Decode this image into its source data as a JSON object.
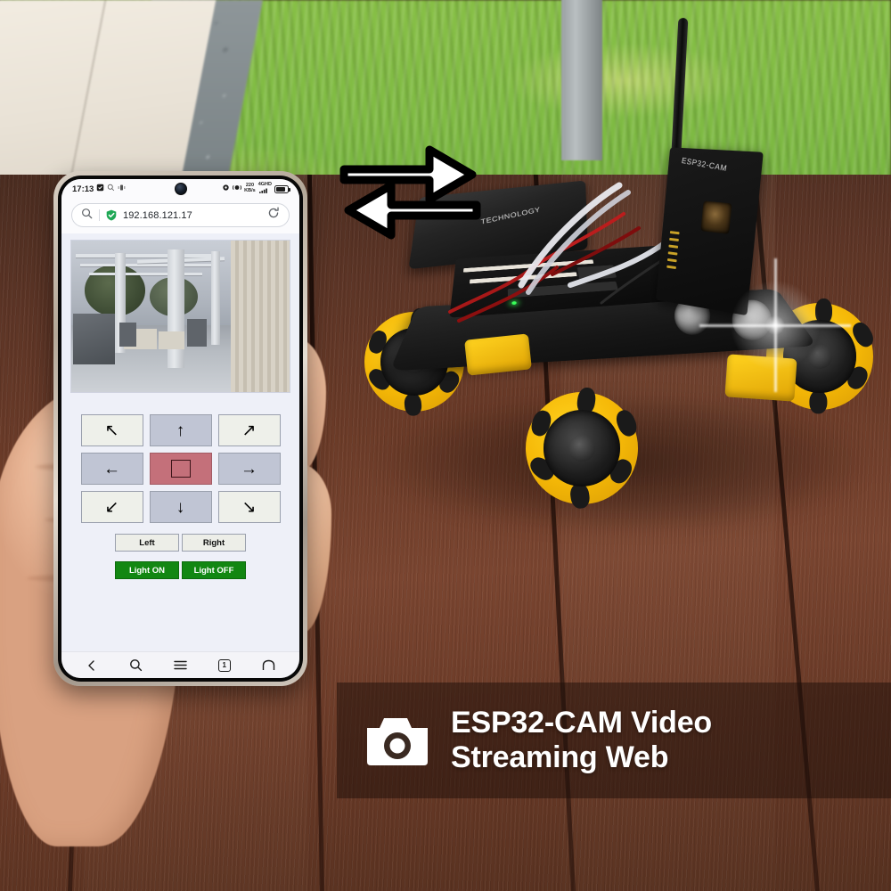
{
  "scene": {
    "description": "Outdoor wooden deck with grass and gravel background",
    "surface": "dark brown wood decking",
    "background_elements": [
      "grass lawn",
      "gravel strip",
      "concrete pavement",
      "gray post"
    ]
  },
  "phone": {
    "status_bar": {
      "time": "17:13",
      "network_speed_value": "220",
      "network_speed_unit": "KB/s",
      "network_type": "4G",
      "network_hd": "HD",
      "icons": [
        "alarm-icon",
        "search-icon",
        "vibrate-icon",
        "camera-punch-hole",
        "bluetooth-icon",
        "nfc-icon",
        "signal-bars-icon",
        "battery-icon"
      ]
    },
    "browser": {
      "url": "192.168.121.17",
      "search_icon": "search-icon",
      "security_icon": "shield-check-icon",
      "reload_icon": "reload-icon",
      "nav": {
        "back": "back-icon",
        "search": "search-icon",
        "menu": "menu-icon",
        "tabs_count": "1",
        "home": "home-icon"
      }
    },
    "web_app": {
      "stream_alt": "ESP32-CAM live video stream of a patio pergola",
      "dpad": [
        [
          {
            "label": "↖",
            "name": "move-up-left",
            "style": "light"
          },
          {
            "label": "↑",
            "name": "move-forward",
            "style": "dark"
          },
          {
            "label": "↗",
            "name": "move-up-right",
            "style": "light"
          }
        ],
        [
          {
            "label": "←",
            "name": "move-left",
            "style": "dark"
          },
          {
            "label": "",
            "name": "stop",
            "style": "stop"
          },
          {
            "label": "→",
            "name": "move-right",
            "style": "dark"
          }
        ],
        [
          {
            "label": "↙",
            "name": "move-down-left",
            "style": "light"
          },
          {
            "label": "↓",
            "name": "move-backward",
            "style": "dark"
          },
          {
            "label": "↘",
            "name": "move-down-right",
            "style": "light"
          }
        ]
      ],
      "turn_buttons": [
        {
          "label": "Left",
          "name": "turn-left"
        },
        {
          "label": "Right",
          "name": "turn-right"
        }
      ],
      "light_buttons": [
        {
          "label": "Light ON",
          "name": "light-on"
        },
        {
          "label": "Light OFF",
          "name": "light-off"
        }
      ]
    }
  },
  "robot": {
    "camera_board_label": "ESP32-CAM",
    "battery_label": "TECHNOLOGY",
    "parts": [
      "mecanum-wheels",
      "esp32-cam-board",
      "ultrasonic-sensor",
      "antenna",
      "battery-pack",
      "motor-driver-board",
      "led-flashlight"
    ]
  },
  "transfer_arrows": {
    "name": "bidirectional-data-arrows",
    "direction": "two-way"
  },
  "banner": {
    "icon": "camera-icon",
    "line1": "ESP32-CAM Video",
    "line2": "Streaming Web",
    "overlay_color": "#1e100a"
  },
  "colors": {
    "page_bg": "#eef0f8",
    "dpad_light": "#eef0ea",
    "dpad_dark": "#c0c5d4",
    "stop_button": "#c4707a",
    "light_button_green": "#128712",
    "shield_green": "#1fa855",
    "wheel_yellow": "#f5b807",
    "deck_brown": "#6b3b28",
    "grass_green": "#7fbb43"
  }
}
